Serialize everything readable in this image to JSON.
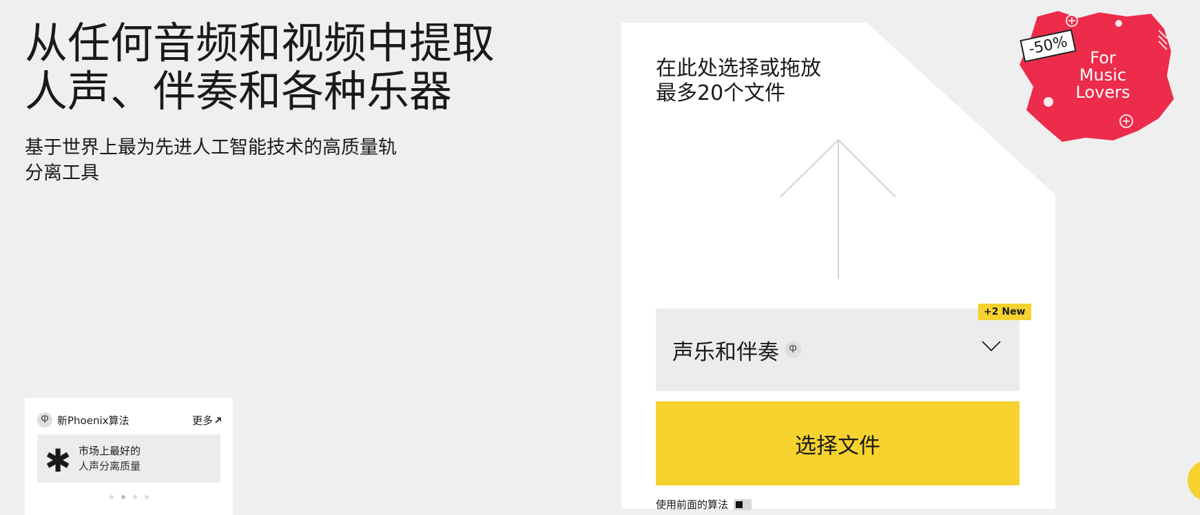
{
  "hero": {
    "title_line1": "从任何音频和视频中提取",
    "title_line2": "人声、伴奏和各种乐器",
    "subtitle_line1": "基于世界上最为先进人工智能技术的高质量轨",
    "subtitle_line2": "分离工具"
  },
  "phoenix_card": {
    "badge": "Ⴔ",
    "title": "新Phoenix算法",
    "more_label": "更多",
    "more_icon": "arrow-up-right-icon",
    "slide_icon": "✱",
    "slide_line1": "市场上最好的",
    "slide_line2": "人声分离质量",
    "dots_total": 4,
    "dot_active": 1
  },
  "upload": {
    "drop_line1": "在此处选择或拖放",
    "drop_line2": "最多20个文件",
    "new_badge": "+2 New",
    "selector_label": "声乐和伴奏",
    "selector_badge": "Ⴔ",
    "select_button": "选择文件",
    "prev_algorithm": "使用前面的算法"
  },
  "promo": {
    "discount": "-50%",
    "line1": "For",
    "line2": "Music",
    "line3": "Lovers"
  },
  "colors": {
    "background": "#efefef",
    "panel": "#ffffff",
    "accent_yellow": "#f5d22d",
    "promo_red": "#ec2c4a"
  }
}
